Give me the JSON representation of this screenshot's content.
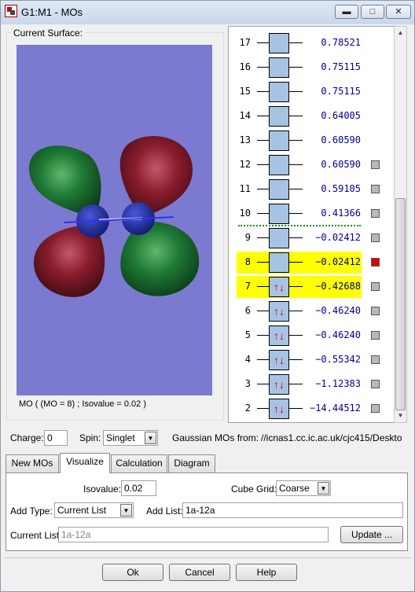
{
  "window": {
    "title": "G1:M1 - MOs",
    "minimize_icon": "minimize-icon",
    "maximize_icon": "maximize-icon",
    "close_icon": "close-icon"
  },
  "surface": {
    "legend": "Current Surface:",
    "caption": "MO ( (MO = 8) ; Isovalue = 0.02 )"
  },
  "orbitals": [
    {
      "number": "17",
      "energy": "0.78521",
      "electrons": 0,
      "highlight": false,
      "checkbox": "none"
    },
    {
      "number": "16",
      "energy": "0.75115",
      "electrons": 0,
      "highlight": false,
      "checkbox": "none"
    },
    {
      "number": "15",
      "energy": "0.75115",
      "electrons": 0,
      "highlight": false,
      "checkbox": "none"
    },
    {
      "number": "14",
      "energy": "0.64005",
      "electrons": 0,
      "highlight": false,
      "checkbox": "none"
    },
    {
      "number": "13",
      "energy": "0.60590",
      "electrons": 0,
      "highlight": false,
      "checkbox": "none"
    },
    {
      "number": "12",
      "energy": "0.60590",
      "electrons": 0,
      "highlight": false,
      "checkbox": "off"
    },
    {
      "number": "11",
      "energy": "0.59105",
      "electrons": 0,
      "highlight": false,
      "checkbox": "off"
    },
    {
      "number": "10",
      "energy": "0.41366",
      "electrons": 0,
      "highlight": false,
      "checkbox": "off"
    },
    {
      "number": "9",
      "energy": "−0.02412",
      "electrons": 0,
      "highlight": false,
      "checkbox": "off"
    },
    {
      "number": "8",
      "energy": "−0.02412",
      "electrons": 0,
      "highlight": true,
      "checkbox": "on"
    },
    {
      "number": "7",
      "energy": "−0.42688",
      "electrons": 2,
      "highlight": true,
      "checkbox": "off"
    },
    {
      "number": "6",
      "energy": "−0.46240",
      "electrons": 2,
      "highlight": false,
      "checkbox": "off"
    },
    {
      "number": "5",
      "energy": "−0.46240",
      "electrons": 2,
      "highlight": false,
      "checkbox": "off"
    },
    {
      "number": "4",
      "energy": "−0.55342",
      "electrons": 2,
      "highlight": false,
      "checkbox": "off"
    },
    {
      "number": "3",
      "energy": "−1.12383",
      "electrons": 2,
      "highlight": false,
      "checkbox": "off"
    },
    {
      "number": "2",
      "energy": "−14.44512",
      "electrons": 2,
      "highlight": false,
      "checkbox": "off"
    }
  ],
  "colors": {
    "occupied_arrow": "#d00000",
    "highlight": "#ffff00",
    "orbital_box": "#a7c3e4",
    "viewport_bg": "#7b7ad0",
    "lobe_green": "#1f7a36",
    "lobe_red": "#8a1d2c"
  },
  "controls": {
    "charge_label": "Charge:",
    "charge_value": "0",
    "spin_label": "Spin:",
    "spin_value": "Singlet",
    "source_label": "Gaussian MOs from:",
    "source_path": "//icnas1.cc.ic.ac.uk/cjc415/Deskto"
  },
  "tabs": [
    {
      "label": "New MOs"
    },
    {
      "label": "Visualize"
    },
    {
      "label": "Calculation"
    },
    {
      "label": "Diagram"
    }
  ],
  "active_tab": "Visualize",
  "visualize": {
    "isovalue_label": "Isovalue:",
    "isovalue_value": "0.02",
    "cube_grid_label": "Cube Grid:",
    "cube_grid_value": "Coarse",
    "add_type_label": "Add Type:",
    "add_type_value": "Current List",
    "add_list_label": "Add List:",
    "add_list_value": "1a-12a",
    "current_list_label": "Current List:",
    "current_list_value": "1a-12a",
    "update_label": "Update ..."
  },
  "footer": {
    "ok_label": "Ok",
    "cancel_label": "Cancel",
    "help_label": "Help"
  }
}
